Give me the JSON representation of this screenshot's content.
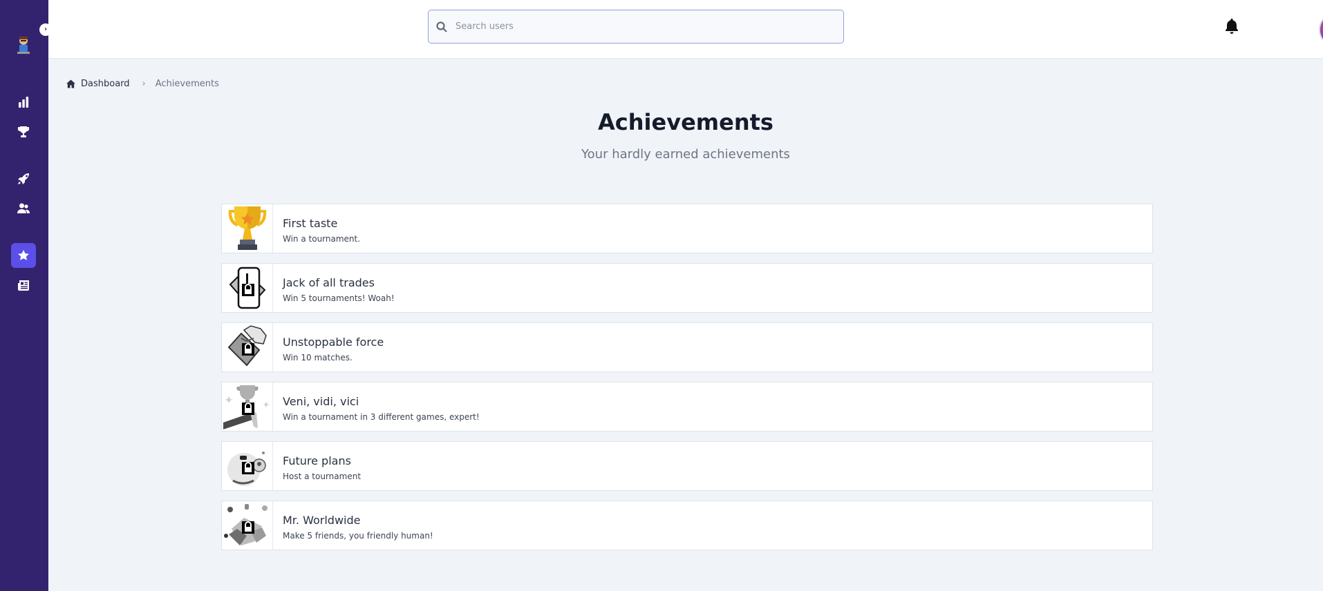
{
  "sidebar": {
    "toggle_label": "›",
    "items": [
      {
        "name": "stats",
        "icon": "bar-chart-icon",
        "active": false
      },
      {
        "name": "tournaments",
        "icon": "trophy-icon",
        "active": false
      },
      {
        "name": "launch",
        "icon": "rocket-icon",
        "active": false
      },
      {
        "name": "friends",
        "icon": "users-icon",
        "active": false
      },
      {
        "name": "achievements",
        "icon": "star-icon",
        "active": true
      },
      {
        "name": "news",
        "icon": "newspaper-icon",
        "active": false
      }
    ],
    "colors": {
      "background": "#33236e",
      "active": "#5b4fe8"
    }
  },
  "topbar": {
    "search": {
      "placeholder": "Search users",
      "value": ""
    },
    "notification_icon": "bell-icon",
    "avatar_icon": "user-avatar"
  },
  "breadcrumb": {
    "home_label": "Dashboard",
    "current_label": "Achievements"
  },
  "header": {
    "title": "Achievements",
    "subtitle": "Your hardly earned achievements"
  },
  "achievements": [
    {
      "title": "First taste",
      "description": "Win a tournament.",
      "icon": "gold-trophy-icon",
      "locked": false
    },
    {
      "title": "Jack of all trades",
      "description": "Win 5 tournaments! Woah!",
      "icon": "card-icon",
      "locked": true
    },
    {
      "title": "Unstoppable force",
      "description": "Win 10 matches.",
      "icon": "force-icon",
      "locked": true
    },
    {
      "title": "Veni, vidi, vici",
      "description": "Win a tournament in 3 different games, expert!",
      "icon": "podium-trophy-icon",
      "locked": true
    },
    {
      "title": "Future plans",
      "description": "Host a tournament",
      "icon": "planning-icon",
      "locked": true
    },
    {
      "title": "Mr. Worldwide",
      "description": "Make 5 friends, you friendly human!",
      "icon": "friends-icon",
      "locked": true
    }
  ]
}
